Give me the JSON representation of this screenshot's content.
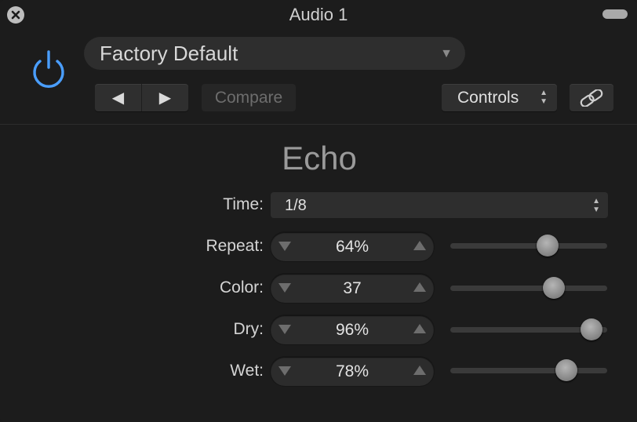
{
  "window": {
    "title": "Audio 1"
  },
  "header": {
    "preset": "Factory Default",
    "prev_symbol": "◀",
    "next_symbol": "▶",
    "compare_label": "Compare",
    "view_label": "Controls"
  },
  "plugin": {
    "name": "Echo",
    "time": {
      "label": "Time:",
      "value": "1/8"
    },
    "params": [
      {
        "label": "Repeat:",
        "value": "64%",
        "level": 0.62
      },
      {
        "label": "Color:",
        "value": "37",
        "level": 0.66
      },
      {
        "label": "Dry:",
        "value": "96%",
        "level": 0.9
      },
      {
        "label": "Wet:",
        "value": "78%",
        "level": 0.74
      }
    ]
  },
  "colors": {
    "accent": "#4a9eff",
    "background": "#1c1c1c"
  },
  "icons": [
    "close-icon",
    "power-icon",
    "link-icon",
    "dropdown-arrow-icon",
    "updown-arrows-icon"
  ]
}
